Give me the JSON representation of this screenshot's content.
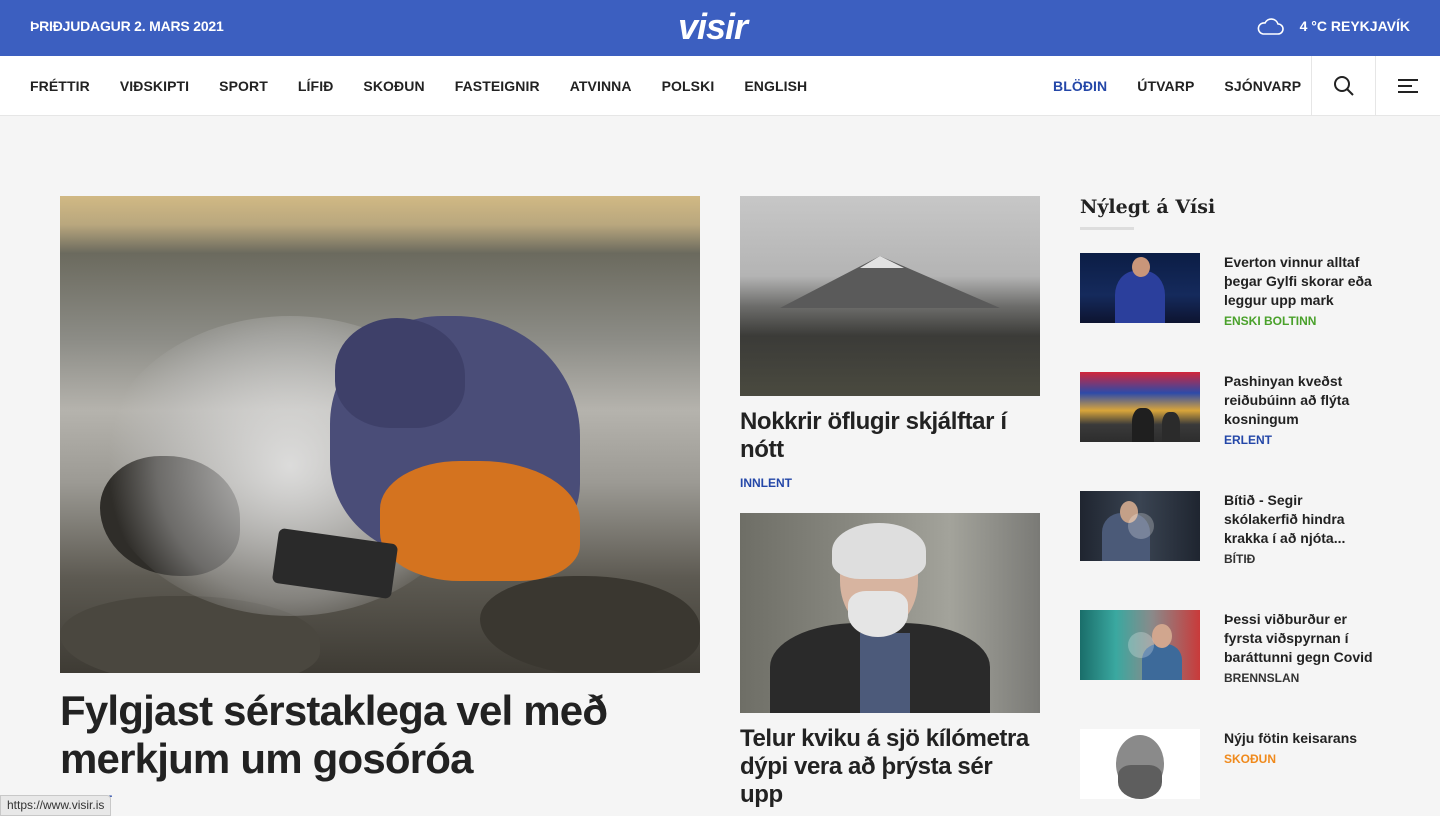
{
  "topbar": {
    "date": "ÞRIÐJUDAGUR 2. MARS 2021",
    "logo": "visir",
    "weather": "4 °C REYKJAVÍK",
    "weather_icon": "cloud-icon"
  },
  "nav": {
    "left": [
      "FRÉTTIR",
      "VIÐSKIPTI",
      "SPORT",
      "LÍFIÐ",
      "SKOÐUN",
      "FASTEIGNIR",
      "ATVINNA",
      "POLSKI",
      "ENGLISH"
    ],
    "right": [
      "BLÖÐIN",
      "ÚTVARP",
      "SJÓNVARP"
    ],
    "active": "BLÖÐIN",
    "active_color": "#2447a8"
  },
  "main": {
    "title": "Fylgjast sérstaklega vel með merkjum um gosóróa",
    "category": "INNLENT"
  },
  "middle": [
    {
      "title": "Nokkrir öflugir skjálftar í nótt",
      "category": "INNLENT"
    },
    {
      "title": "Telur kviku á sjö kílómetra dýpi vera að þrýsta sér upp",
      "category": ""
    }
  ],
  "sidebar": {
    "title": "Nýlegt á Vísi",
    "items": [
      {
        "headline": "Everton vinnur alltaf þegar Gylfi skorar eða leggur upp mark",
        "category": "ENSKI BOLTINN",
        "category_color": "#4aa12b"
      },
      {
        "headline": "Pashinyan kveðst reiðubúinn að flýta kosningum",
        "category": "ERLENT",
        "category_color": "#2447a8"
      },
      {
        "headline": "Bítið - Segir skólakerfið hindra krakka í að njóta...",
        "category": "BÍTIÐ",
        "category_color": "#333333"
      },
      {
        "headline": "Þessi viðburður er fyrsta viðspyrnan í baráttunni gegn Covid",
        "category": "BRENNSLAN",
        "category_color": "#333333"
      },
      {
        "headline": "Nýju fötin keisarans",
        "category": "SKOÐUN",
        "category_color": "#f08a1c"
      }
    ]
  },
  "statusbar": {
    "url": "https://www.visir.is"
  },
  "colors": {
    "brand": "#3c5fc0",
    "link": "#2447a8"
  }
}
